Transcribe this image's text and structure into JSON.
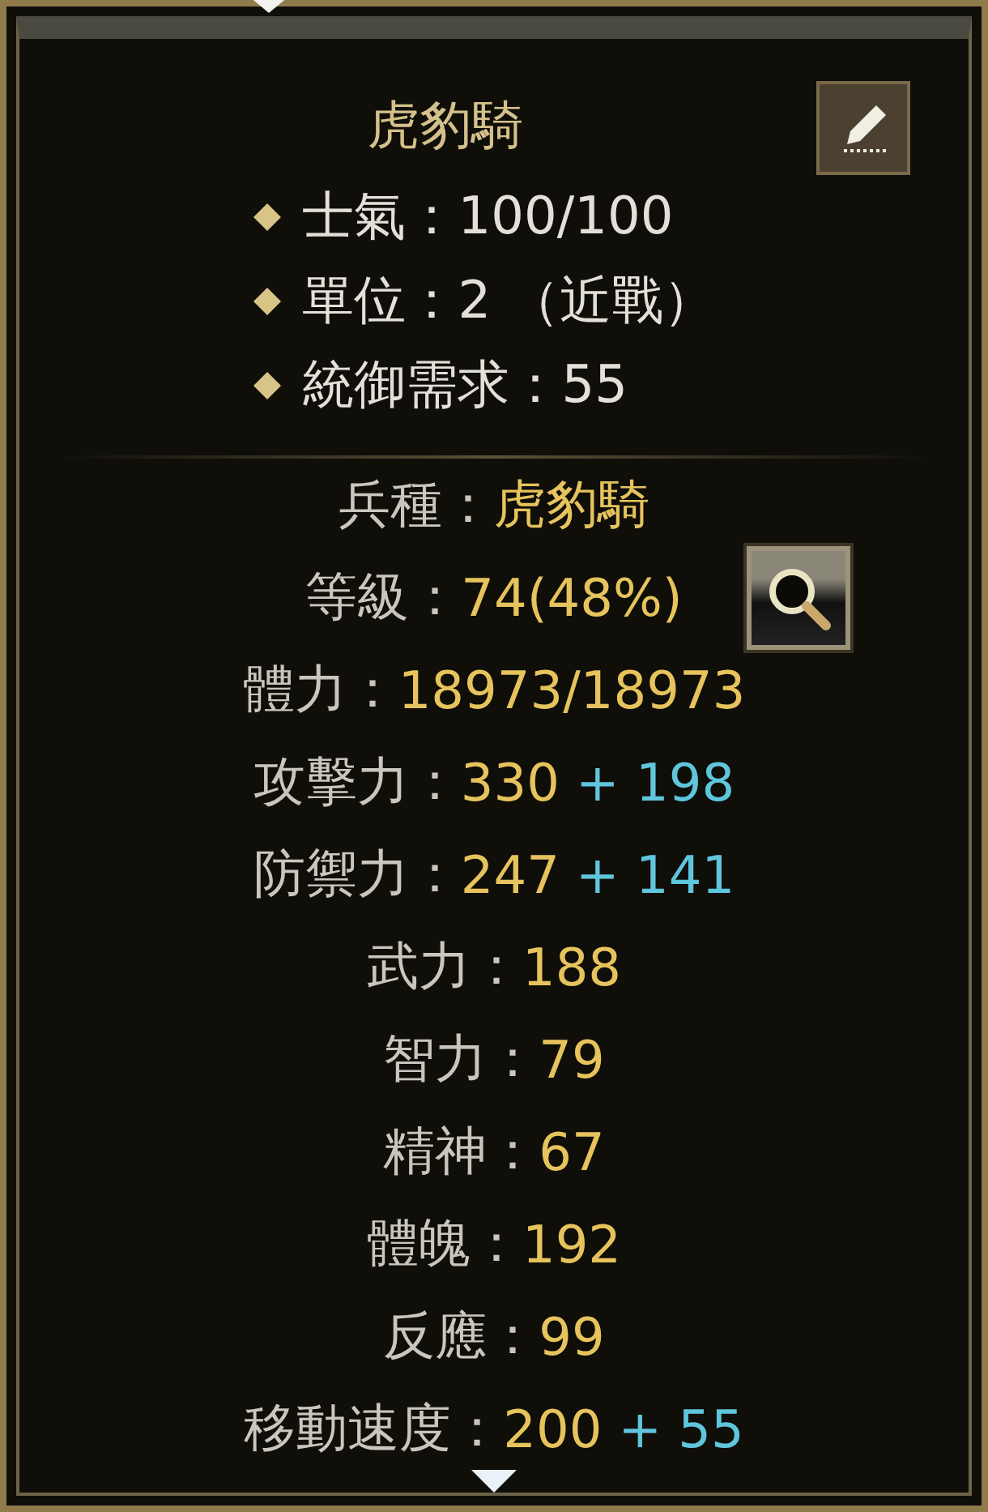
{
  "title": "虎豹騎",
  "info": [
    "士氣：100/100",
    "單位：2 （近戰）",
    "統御需求：55"
  ],
  "stats": [
    {
      "kind": "plain",
      "label": "兵種：",
      "value": "虎豹騎"
    },
    {
      "kind": "inspect",
      "label": "等級：",
      "value": "74(48%)"
    },
    {
      "kind": "plain",
      "label": "體力：",
      "value": "18973/18973"
    },
    {
      "kind": "plain",
      "label": "攻擊力：",
      "value": "330",
      "bonus": "+ 198"
    },
    {
      "kind": "plain",
      "label": "防禦力：",
      "value": "247",
      "bonus": "+ 141"
    },
    {
      "kind": "plain",
      "label": "武力：",
      "value": "188"
    },
    {
      "kind": "plain",
      "label": "智力：",
      "value": "79"
    },
    {
      "kind": "plain",
      "label": "精神：",
      "value": "67"
    },
    {
      "kind": "plain",
      "label": "體魄：",
      "value": "192"
    },
    {
      "kind": "plain",
      "label": "反應：",
      "value": "99"
    },
    {
      "kind": "plain",
      "label": "移動速度：",
      "value": "200",
      "bonus": "+ 55"
    }
  ]
}
